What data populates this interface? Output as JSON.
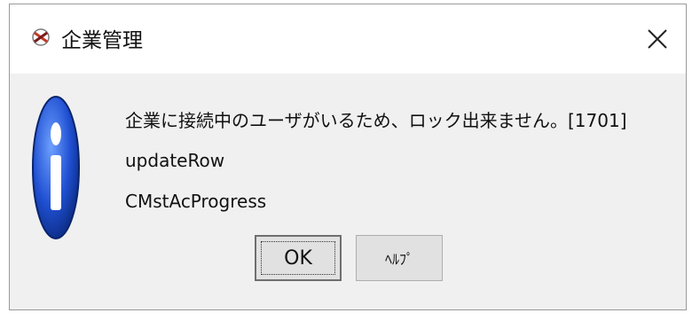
{
  "dialog": {
    "title": "企業管理",
    "app_icon": "app-logo-icon",
    "close_icon": "close-icon",
    "message_icon": "info-icon",
    "message_lines": [
      "企業に接続中のユーザがいるため、ロック出来ません。[1701]",
      "updateRow",
      "CMstAcProgress"
    ],
    "buttons": {
      "ok_label": "OK",
      "help_label": "ﾍﾙﾌﾟ"
    }
  },
  "colors": {
    "dialog_bg": "#f0f0f0",
    "titlebar_bg": "#ffffff",
    "button_bg": "#e1e1e1",
    "info_icon_blue": "#1f4fd1"
  }
}
